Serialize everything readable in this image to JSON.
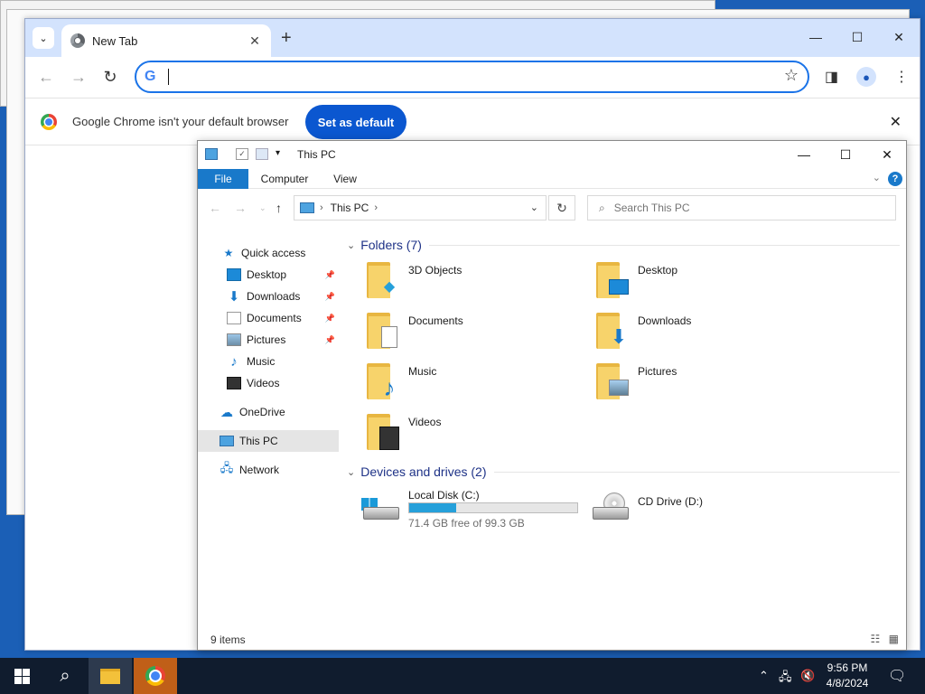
{
  "chrome": {
    "tab_title": "New Tab",
    "tab_close": "✕",
    "new_tab": "+",
    "tab_search": "⌄",
    "omnibox_value": "",
    "infobar_message": "Google Chrome isn't your default browser",
    "set_default_label": "Set as default",
    "win_minimize": "—",
    "win_maximize": "☐",
    "win_close": "✕"
  },
  "explorer": {
    "title": "This PC",
    "ribbon_tabs": [
      "File",
      "Computer",
      "View"
    ],
    "address_location": "This PC",
    "search_placeholder": "Search This PC",
    "nav": {
      "quick_access": "Quick access",
      "items": [
        "Desktop",
        "Downloads",
        "Documents",
        "Pictures",
        "Music",
        "Videos"
      ],
      "onedrive": "OneDrive",
      "this_pc": "This PC",
      "network": "Network"
    },
    "folders_header": "Folders (7)",
    "folders": [
      "3D Objects",
      "Desktop",
      "Documents",
      "Downloads",
      "Music",
      "Pictures",
      "Videos"
    ],
    "devices_header": "Devices and drives (2)",
    "drives": [
      {
        "name": "Local Disk (C:)",
        "free": "71.4 GB free of 99.3 GB",
        "used_fraction": 0.28
      },
      {
        "name": "CD Drive (D:)"
      }
    ],
    "status": "9 items",
    "help": "?"
  },
  "taskbar": {
    "time": "9:56 PM",
    "date": "4/8/2024"
  },
  "colors": {
    "accent": "#1979ca",
    "chrome_button": "#0b57d0",
    "taskbar": "#101c2e"
  }
}
